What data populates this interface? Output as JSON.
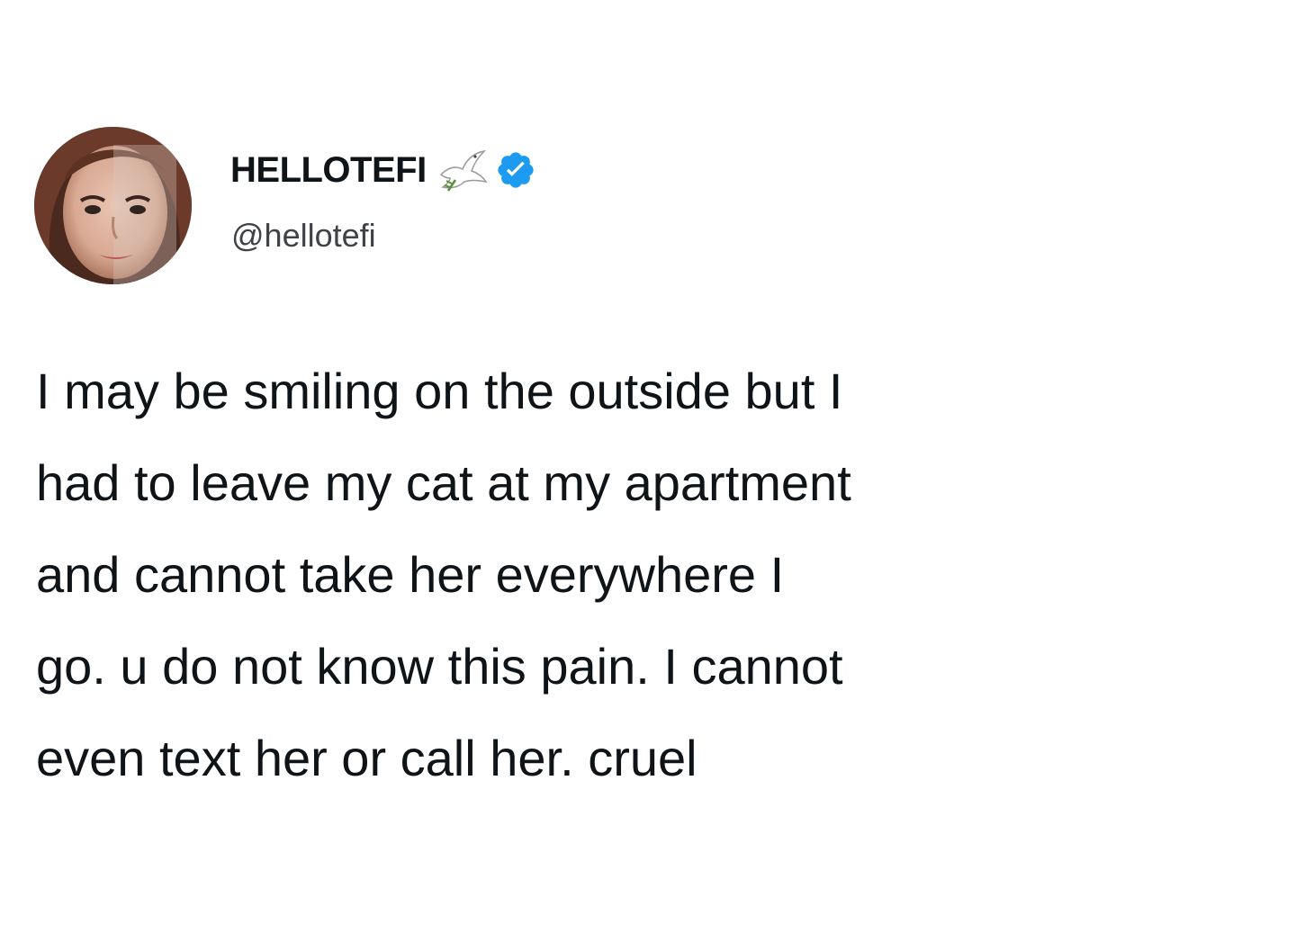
{
  "tweet": {
    "author": {
      "display_name": "HELLOTEFI",
      "handle": "@hellotefi",
      "badge_icons": [
        "dove-icon",
        "verified-badge-icon"
      ],
      "verified_color": "#1d9bf0"
    },
    "text_lines": [
      "I may be smiling on the outside but I",
      "had to leave my cat at my apartment",
      "and cannot take her everywhere I",
      "go. u do not know this pain. I cannot",
      "even text her or call her. cruel"
    ]
  }
}
